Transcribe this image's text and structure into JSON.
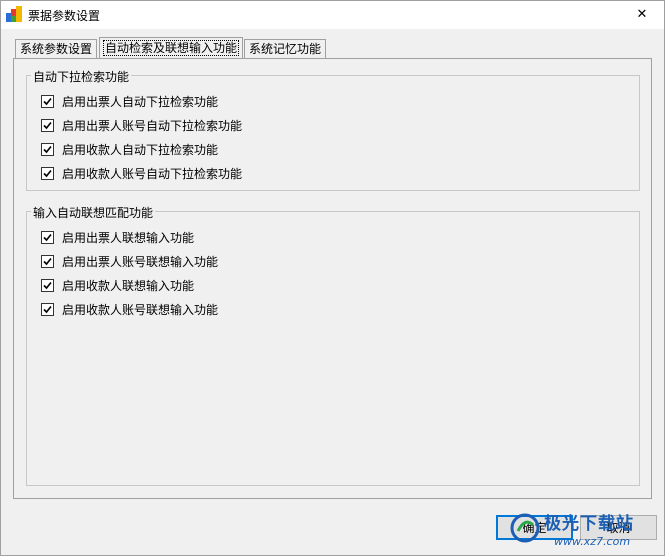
{
  "window": {
    "title": "票据参数设置",
    "close_glyph": "✕"
  },
  "tabs": [
    {
      "label": "系统参数设置",
      "active": false
    },
    {
      "label": "自动检索及联想输入功能",
      "active": true
    },
    {
      "label": "系统记忆功能",
      "active": false
    }
  ],
  "groups": {
    "dropdown": {
      "title": "自动下拉检索功能",
      "items": [
        {
          "label": "启用出票人自动下拉检索功能",
          "checked": true
        },
        {
          "label": "启用出票人账号自动下拉检索功能",
          "checked": true
        },
        {
          "label": "启用收款人自动下拉检索功能",
          "checked": true
        },
        {
          "label": "启用收款人账号自动下拉检索功能",
          "checked": true
        }
      ]
    },
    "association": {
      "title": "输入自动联想匹配功能",
      "items": [
        {
          "label": "启用出票人联想输入功能",
          "checked": true
        },
        {
          "label": "启用出票人账号联想输入功能",
          "checked": true
        },
        {
          "label": "启用收款人联想输入功能",
          "checked": true
        },
        {
          "label": "启用收款人账号联想输入功能",
          "checked": true
        }
      ]
    }
  },
  "buttons": {
    "ok": "确定",
    "cancel": "取消"
  },
  "watermark": {
    "title": "极光下载站",
    "url": "www.xz7.com"
  },
  "colors": {
    "accent": "#0078d7",
    "watermark": "#1a5fb4"
  }
}
